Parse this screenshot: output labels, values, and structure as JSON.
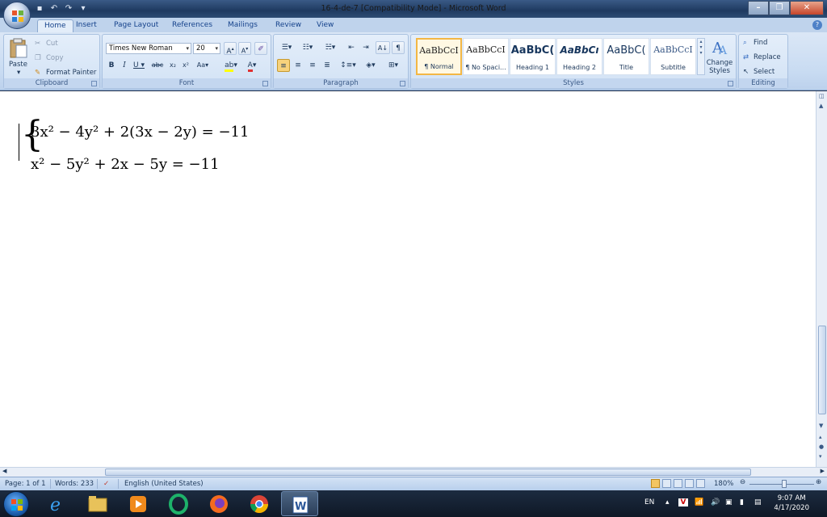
{
  "window": {
    "title": "16-4-de-7 [Compatibility Mode] - Microsoft Word"
  },
  "tabs": [
    "Home",
    "Insert",
    "Page Layout",
    "References",
    "Mailings",
    "Review",
    "View"
  ],
  "clipboard": {
    "paste": "Paste",
    "cut": "Cut",
    "copy": "Copy",
    "format_painter": "Format Painter",
    "group": "Clipboard"
  },
  "font": {
    "name": "Times New Roman",
    "size": "20",
    "group": "Font"
  },
  "paragraph": {
    "group": "Paragraph"
  },
  "styles": {
    "items": [
      {
        "sample": "AaBbCcI",
        "label": "¶ Normal"
      },
      {
        "sample": "AaBbCcI",
        "label": "¶ No Spaci..."
      },
      {
        "sample": "AaBbC(",
        "label": "Heading 1"
      },
      {
        "sample": "AaBbCı",
        "label": "Heading 2"
      },
      {
        "sample": "AaBbC(",
        "label": "Title"
      },
      {
        "sample": "AaBbCcI",
        "label": "Subtitle"
      }
    ],
    "change_styles": "Change Styles",
    "group": "Styles"
  },
  "editing": {
    "find": "Find",
    "replace": "Replace",
    "select": "Select",
    "group": "Editing"
  },
  "document": {
    "line1": "3x² − 4y² + 2(3x − 2y) = −11",
    "line2": "x² − 5y² + 2x − 5y = −11"
  },
  "status": {
    "page": "Page: 1 of 1",
    "words": "Words: 233",
    "language": "English (United States)",
    "zoom": "180%"
  },
  "taskbar": {
    "lang": "EN",
    "time": "9:07 AM",
    "date": "4/17/2020"
  }
}
